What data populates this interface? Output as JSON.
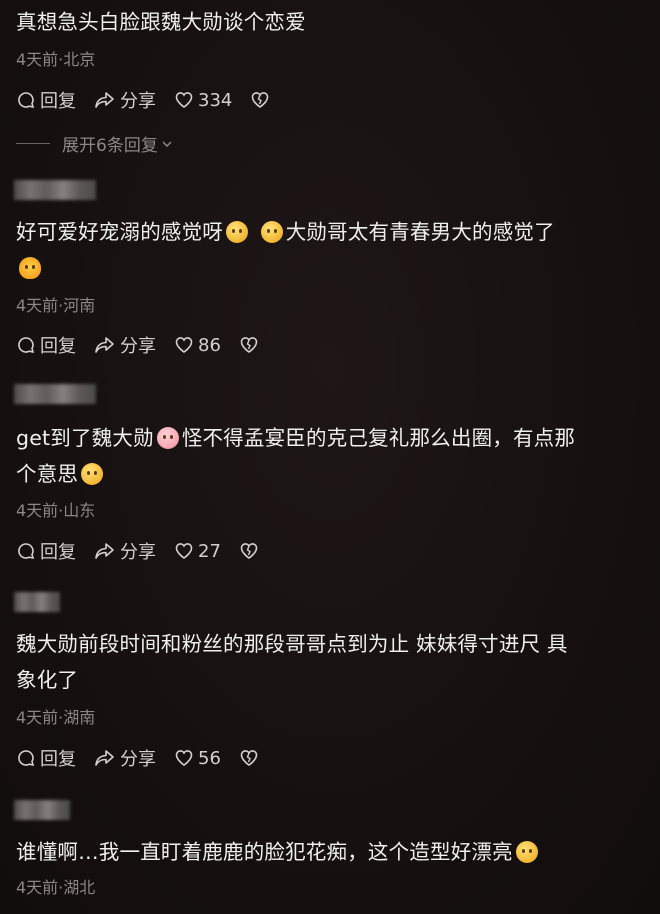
{
  "comments": [
    {
      "text": "真想急头白脸跟魏大勋谈个恋爱",
      "meta": "4天前·北京",
      "reply": "回复",
      "share": "分享",
      "likes": "334",
      "expand": "展开6条回复"
    },
    {
      "text_a": "好可爱好宠溺的感觉呀",
      "text_b": "大勋哥太有青春男大的感觉了",
      "meta": "4天前·河南",
      "reply": "回复",
      "share": "分享",
      "likes": "86"
    },
    {
      "text_a": "get到了魏大勋",
      "text_b": "怪不得孟宴臣的克己复礼那么出圈，有点那",
      "text_c": "个意思",
      "meta": "4天前·山东",
      "reply": "回复",
      "share": "分享",
      "likes": "27"
    },
    {
      "text_a": "魏大勋前段时间和粉丝的那段哥哥点到为止 妹妹得寸进尺 具",
      "text_b": "象化了",
      "meta": "4天前·湖南",
      "reply": "回复",
      "share": "分享",
      "likes": "56"
    },
    {
      "text": "谁懂啊…我一直盯着鹿鹿的脸犯花痴，这个造型好漂亮",
      "meta": "4天前·湖北"
    }
  ],
  "icons": {
    "reply": "reply-bubble-icon",
    "share": "share-arrow-icon",
    "like": "heart-icon",
    "dislike": "broken-heart-icon",
    "expand": "chevron-down-icon"
  }
}
